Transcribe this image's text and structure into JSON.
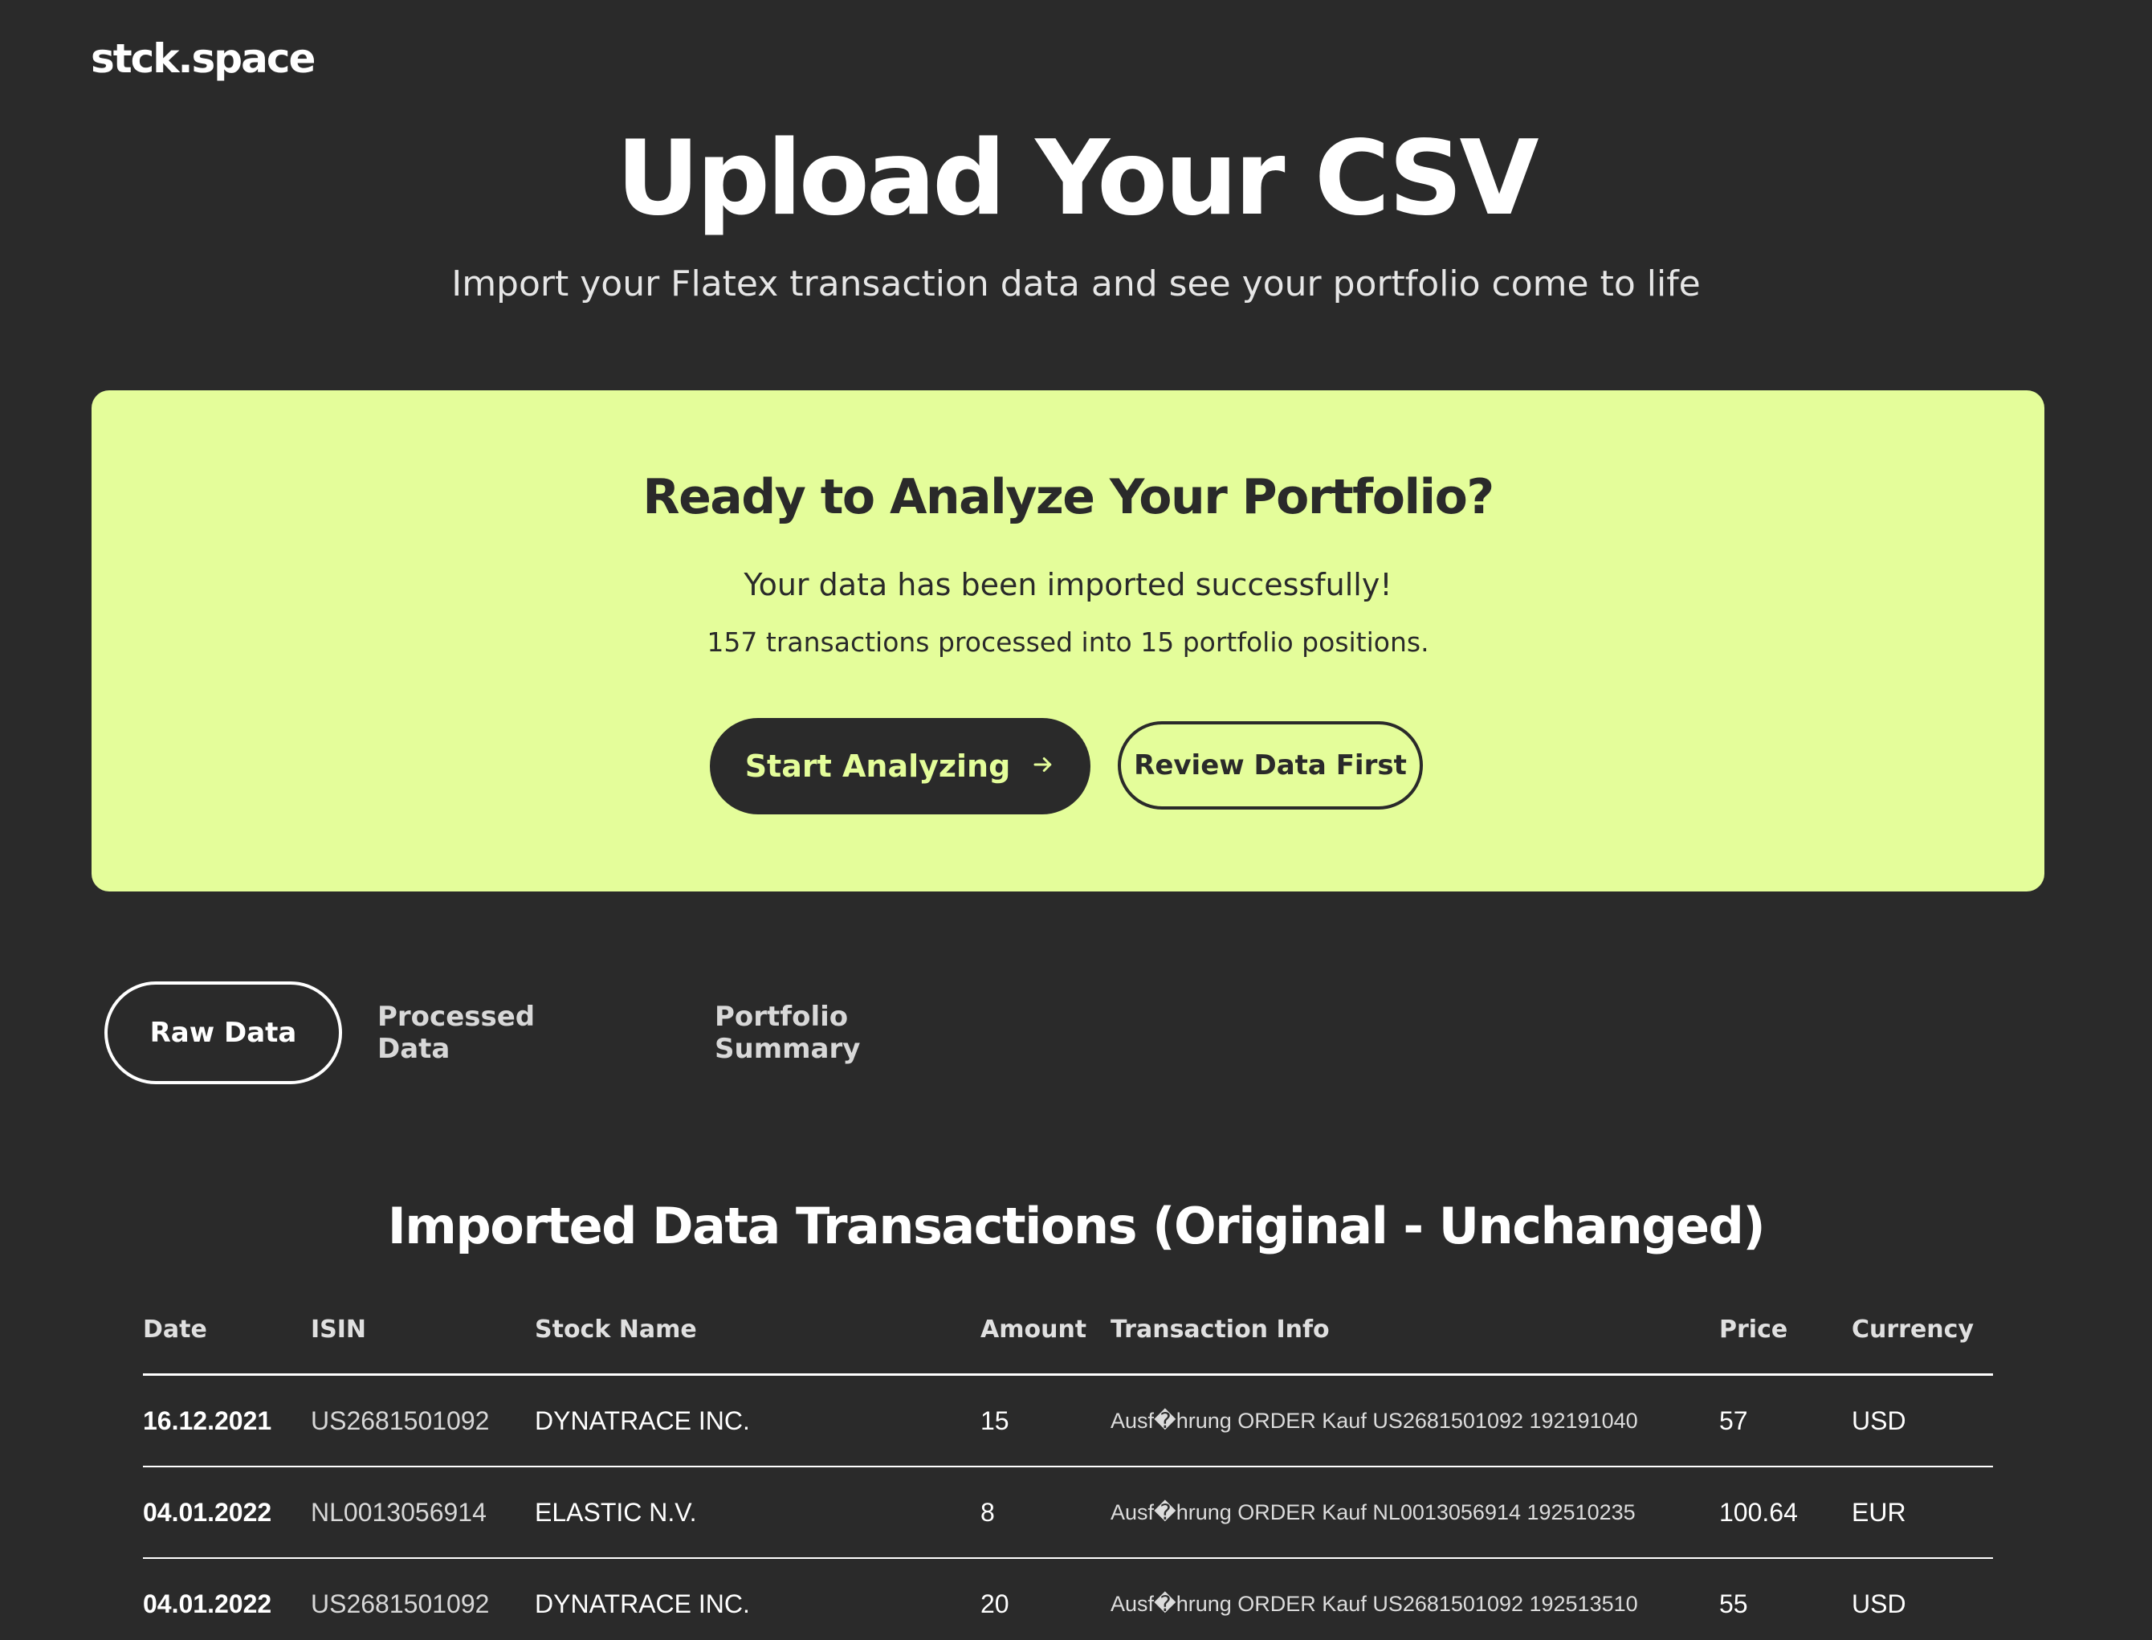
{
  "brand": {
    "logo_text": "stck.space"
  },
  "hero": {
    "title": "Upload Your CSV",
    "subtitle": "Import your Flatex transaction data and see your portfolio come to life"
  },
  "success_card": {
    "title": "Ready to Analyze Your Portfolio?",
    "message": "Your data has been imported successfully!",
    "stats": "157 transactions processed into 15 portfolio positions.",
    "primary_button": "Start Analyzing",
    "secondary_button": "Review Data First",
    "background_color": "#e4fd9a"
  },
  "tabs": [
    {
      "label": "Raw Data",
      "active": true
    },
    {
      "label": "Processed Data",
      "active": false
    },
    {
      "label": "Portfolio Summary",
      "active": false
    }
  ],
  "table": {
    "title": "Imported Data Transactions (Original - Unchanged)",
    "columns": [
      "Date",
      "ISIN",
      "Stock Name",
      "Amount",
      "Transaction Info",
      "Price",
      "Currency"
    ],
    "rows": [
      [
        "16.12.2021",
        "US2681501092",
        "DYNATRACE INC.",
        "15",
        "Ausf�hrung ORDER Kauf US2681501092 192191040",
        "57",
        "USD"
      ],
      [
        "04.01.2022",
        "NL0013056914",
        "ELASTIC N.V.",
        "8",
        "Ausf�hrung ORDER Kauf NL0013056914 192510235",
        "100.64",
        "EUR"
      ],
      [
        "04.01.2022",
        "US2681501092",
        "DYNATRACE INC.",
        "20",
        "Ausf�hrung ORDER Kauf US2681501092 192513510",
        "55",
        "USD"
      ]
    ]
  }
}
